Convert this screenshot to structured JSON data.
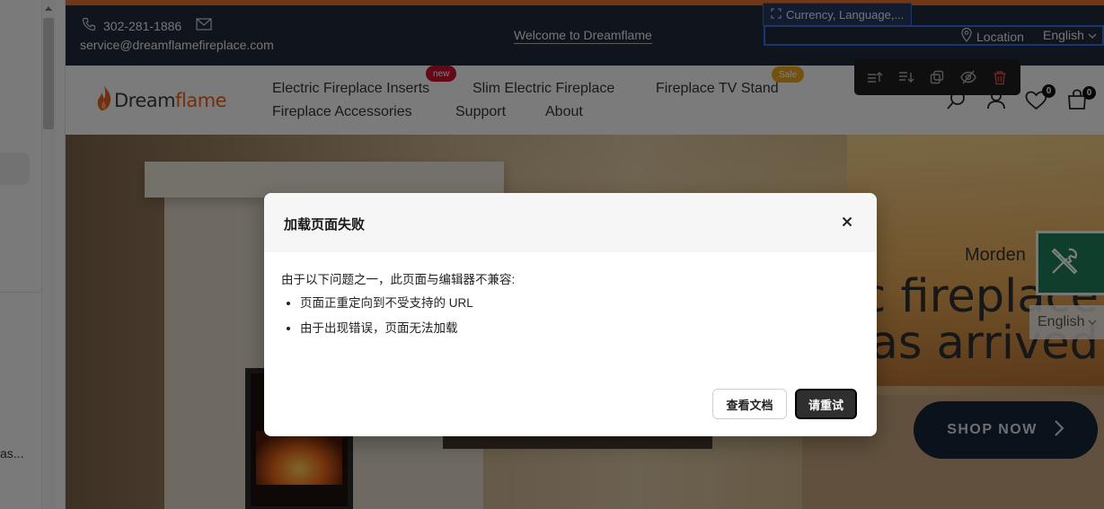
{
  "left_panel": {
    "truncated_text": "as..."
  },
  "topbar": {
    "phone": "302-281-1886",
    "email": "service@dreamflamefireplace.com",
    "welcome": "Welcome to Dreamflame",
    "selection_label": "Currency, Language,...",
    "location": "Location",
    "language": "English"
  },
  "navbar": {
    "logo_part1": "Dream",
    "logo_part2": "flame",
    "items": [
      {
        "label": "Electric Fireplace Inserts",
        "badge": "new"
      },
      {
        "label": "Slim Electric Fireplace"
      },
      {
        "label": "Fireplace TV Stand",
        "badge": "Sale"
      },
      {
        "label": "Fireplace Accessories"
      },
      {
        "label": "Support"
      },
      {
        "label": "About"
      }
    ],
    "wishlist_count": "0",
    "cart_count": "0"
  },
  "hero": {
    "subtitle": "Morden",
    "title_line1": "c fireplace",
    "title_line2": "as arrived",
    "cta": "SHOP NOW",
    "language": "English"
  },
  "modal": {
    "title": "加载页面失败",
    "intro": "由于以下问题之一，此页面与编辑器不兼容:",
    "reasons": [
      "页面正重定向到不受支持的 URL",
      "由于出现错误，页面无法加载"
    ],
    "docs_button": "查看文档",
    "retry_button": "请重试"
  },
  "colors": {
    "topbar_bg": "#202938",
    "accent_orange": "#e56f2e",
    "badge_new": "#c8102e",
    "badge_sale": "#e8a21c",
    "cta_bg": "#152437",
    "tools_green": "#1e7c58"
  }
}
